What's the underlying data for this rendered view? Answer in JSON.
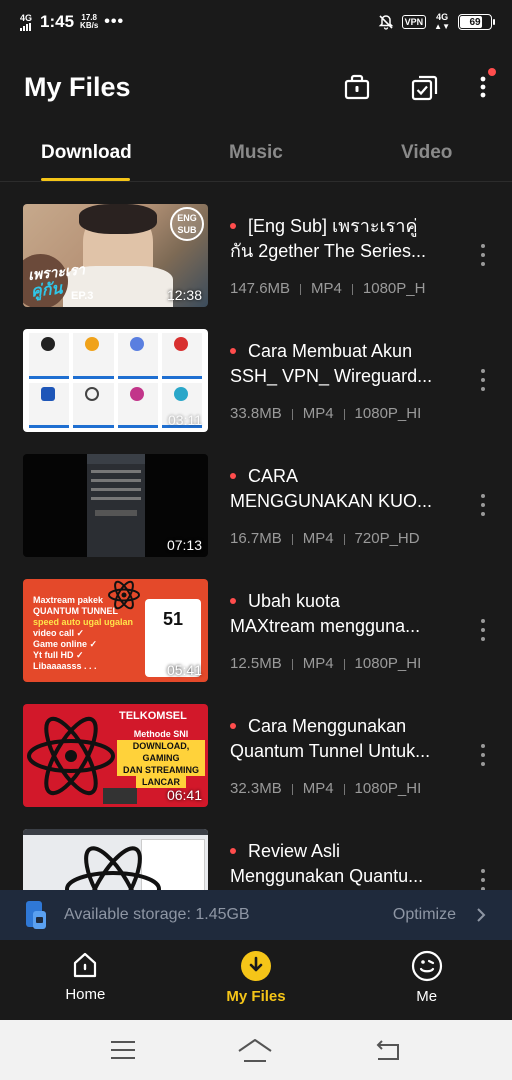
{
  "status": {
    "net_type": "4G",
    "time": "1:45",
    "speed_value": "17.8",
    "speed_unit": "KB/s",
    "more": "•••",
    "vpn": "VPN",
    "net_type_right": "4G",
    "battery": "69"
  },
  "header": {
    "title": "My Files"
  },
  "tabs": [
    {
      "label": "Download",
      "active": true
    },
    {
      "label": "Music",
      "active": false
    },
    {
      "label": "Video",
      "active": false
    }
  ],
  "files": [
    {
      "title1": "[Eng Sub] เพราะเราคู่",
      "title2": "กัน 2gether The Series...",
      "size": "147.6MB",
      "format": "MP4",
      "quality": "1080P_H",
      "duration": "12:38"
    },
    {
      "title1": "Cara Membuat Akun",
      "title2": "SSH_ VPN_ Wireguard...",
      "size": "33.8MB",
      "format": "MP4",
      "quality": "1080P_HI",
      "duration": "03:11"
    },
    {
      "title1": "CARA",
      "title2": "MENGGUNAKAN KUO...",
      "size": "16.7MB",
      "format": "MP4",
      "quality": "720P_HD",
      "duration": "07:13"
    },
    {
      "title1": "Ubah kuota",
      "title2": "MAXtream mengguna...",
      "size": "12.5MB",
      "format": "MP4",
      "quality": "1080P_HI",
      "duration": "05:41"
    },
    {
      "title1": "Cara Menggunakan",
      "title2": "Quantum Tunnel Untuk...",
      "size": "32.3MB",
      "format": "MP4",
      "quality": "1080P_HI",
      "duration": "06:41"
    },
    {
      "title1": "Review Asli",
      "title2": "Menggunakan Quantu...",
      "size": "",
      "format": "",
      "quality": "",
      "duration": ""
    }
  ],
  "thumbs": {
    "t1_badge_top": "ENG",
    "t1_badge_bottom": "SUB",
    "t1_script": "เพราะเรา",
    "t1_script2": "คู่กัน",
    "t1_ep": "EP.3",
    "t4_line1": "Maxtream pakek",
    "t4_line2": "QUANTUM TUNNEL",
    "t4_line3": "speed auto ugal ugalan",
    "t4_line4": "video call ✓",
    "t4_line5": "Game online ✓",
    "t4_line6": "Yt full HD ✓",
    "t4_line7": "Libaaaasss . . .",
    "t4_speed": "51",
    "t5_brand": "TELKOMSEL",
    "t5_line1": "Methode SNI",
    "t5_line2": "DOWNLOAD, GAMING",
    "t5_line3": "DAN STREAMING",
    "t5_line4": "LANCAR"
  },
  "storage": {
    "text": "Available storage: 1.45GB",
    "action": "Optimize"
  },
  "bottom_nav": [
    {
      "label": "Home",
      "active": false
    },
    {
      "label": "My Files",
      "active": true
    },
    {
      "label": "Me",
      "active": false
    }
  ],
  "colors": {
    "accent": "#f5c518",
    "background": "#1a1a1a",
    "unread_dot": "#ff4d4d",
    "storage_bar": "#1f2a3c"
  }
}
